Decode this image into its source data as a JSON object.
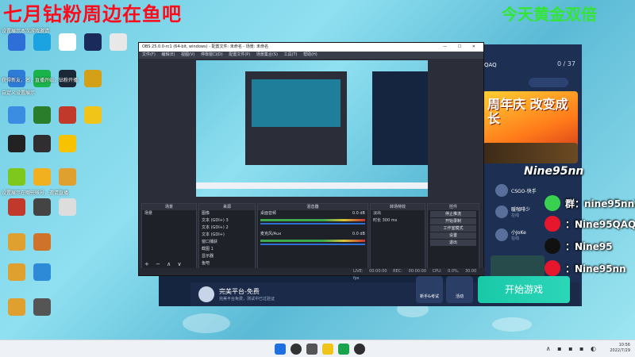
{
  "overlay": {
    "red_text": "七月钻粉周边在鱼吧",
    "green_text": "今天黄金双倍"
  },
  "desktop": {
    "notes": [
      "设置展示本次游戏邀请",
      "获得新友，名，直播开始，钻粉开播",
      "自定义设置展示",
      "设置展示在哪些帐号，邀请直播"
    ]
  },
  "launcher": {
    "title": "QAQ",
    "count": "0 / 37",
    "banner_text": "周年庆 改变成长",
    "friends": [
      {
        "name": "CSGO-快手",
        "status": ""
      },
      {
        "name": "暖咖啡少",
        "status": "在线"
      },
      {
        "name": "小JoKe",
        "status": "在线"
      }
    ],
    "game_title": "完美平台-免费",
    "game_sub": "完美平台免费，测试中已过验证",
    "tool1": "新手&考试",
    "tool2": "活动",
    "start_button": "开始游戏",
    "nine95": "Nine95nn"
  },
  "social": [
    {
      "label": "群：nine95nn1",
      "color": "#3ad04f",
      "icon": "wechat-icon"
    },
    {
      "label": "：Nine95QAQ",
      "color": "#e6162d",
      "icon": "weibo-icon"
    },
    {
      "label": "：Nine95",
      "color": "#111111",
      "icon": "tiktok-icon"
    },
    {
      "label": "：Nine95nn",
      "color": "#e6162d",
      "icon": "netease-icon"
    }
  ],
  "obs": {
    "window_title": "OBS 25.0.0-rc1 (64-bit, windows) - 配置文件: 未命名 - 场景: 未命名",
    "menu": [
      "文件(F)",
      "编辑(E)",
      "视图(V)",
      "停靠窗口(D)",
      "配置文件(P)",
      "场景集合(S)",
      "工具(T)",
      "帮助(H)"
    ],
    "docks": {
      "scenes": {
        "title": "场景",
        "items": [
          "场景"
        ]
      },
      "sources": {
        "title": "来源",
        "items": [
          "图像",
          "文本 (GDI+) 3",
          "文本 (GDI+) 2",
          "文本 (GDI+)",
          "窗口捕获",
          "截图 1",
          "显示器",
          "鱼吧"
        ]
      },
      "mixer": {
        "title": "混音器",
        "tracks": [
          {
            "name": "桌面音频",
            "db": "0.0 dB"
          },
          {
            "name": "麦克风/Aux",
            "db": "0.0 dB"
          }
        ]
      },
      "transitions": {
        "title": "转场特效",
        "mode": "淡出",
        "duration_label": "时长",
        "duration": "300 ms"
      },
      "controls": {
        "title": "控件",
        "buttons": [
          "停止推流",
          "开始录制",
          "工作室模式",
          "设置",
          "退出"
        ]
      }
    },
    "status": {
      "live": "LIVE: 00:00:00",
      "rec": "REC: 00:00:00",
      "cpu": "CPU: 0.0%, 30.00 fps"
    }
  },
  "taskbar": {
    "time": "10:56",
    "date": "2022/7/29"
  }
}
